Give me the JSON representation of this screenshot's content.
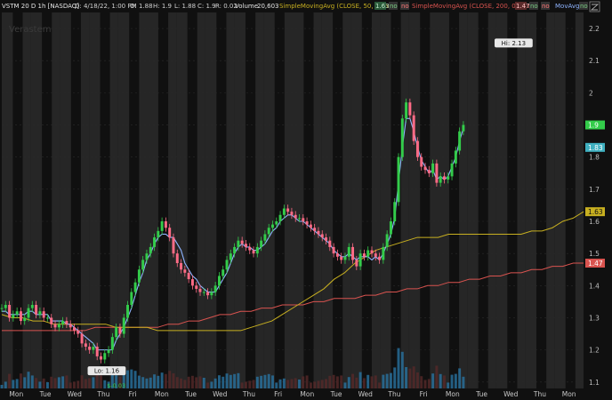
{
  "header": {
    "symbol": "VSTM 20 D 1h [NASDAQ]",
    "date_label": "D: 4/18/22, 1:00 PM",
    "open_label": "O: 1.88",
    "high_label": "H: 1.9",
    "low_label": "L: 1.88",
    "close_label": "C: 1.9",
    "range_label": "R: 0.02",
    "volume_label": "Volume",
    "volume_value": "20,603",
    "sma50_label": "SimpleMovingAvg (CLOSE, 50, 0, yes)",
    "sma50_value": "1.63",
    "na_1": "no",
    "sma200_label": "SimpleMovingAvg (CLOSE, 200, 0, yes)",
    "sma200_value": "1.47",
    "na_2": "no",
    "movavg_label": "MovAvg"
  },
  "watermark": "Verastem",
  "colors": {
    "background": "#101010",
    "session_band": "#2a2a2a",
    "bull": "#33cc4a",
    "bear": "#ff6b86",
    "sma50": "#c8b020",
    "sma200": "#d9534f",
    "ma_fast": "#8fb4ff",
    "volume": "#2a78a8",
    "volume_bear": "#5a2a2a"
  },
  "chart_data": {
    "type": "candlestick",
    "ylim": [
      1.08,
      2.25
    ],
    "yticks": [
      1.1,
      1.2,
      1.3,
      1.4,
      1.5,
      1.6,
      1.7,
      1.8,
      1.9,
      2.0,
      2.1,
      2.2
    ],
    "ytick_labels": [
      "1.1",
      "1.2",
      "1.3",
      "1.4",
      "1.5",
      "1.6",
      "1.7",
      "1.8",
      "1.9",
      "2",
      "2.1",
      "2.2"
    ],
    "xtick_labels": [
      "Mon",
      "Tue",
      "Wed",
      "Thu",
      "Fri",
      "Mon",
      "Tue",
      "Wed",
      "Thu",
      "Fri",
      "Mon",
      "Tue",
      "Wed",
      "Thu",
      "Fri",
      "Mon",
      "Tue",
      "Wed",
      "Thu",
      "Mon"
    ],
    "price_x": [
      0,
      24,
      48,
      72,
      96,
      120,
      144,
      168,
      192,
      216,
      240,
      264,
      288,
      312,
      336,
      360,
      384,
      408,
      432,
      456,
      480,
      504,
      528,
      552,
      576,
      600,
      624,
      648,
      672,
      696,
      720,
      744,
      768,
      792,
      816,
      840,
      864,
      888,
      912,
      936,
      960,
      984,
      1008,
      1032,
      1056,
      1080,
      1104,
      1128,
      1152,
      1176,
      1200,
      1224,
      1248,
      1272,
      1296,
      1320,
      1344,
      1368,
      1392,
      1416,
      1440,
      1464,
      1488,
      1512,
      1536,
      1560,
      1584,
      1608,
      1632,
      1656,
      1680,
      1704,
      1728,
      1752,
      1776,
      1800,
      1824,
      1848,
      1872,
      1896,
      1920,
      1944,
      1968,
      1992,
      2016,
      2040,
      2064,
      2088,
      2112,
      2136,
      2160,
      2184,
      2208,
      2232,
      2256,
      2280,
      2304,
      2328,
      2352,
      2376,
      2400,
      2424,
      2448,
      2472,
      2496,
      2520,
      2544,
      2568,
      2592,
      2616,
      2640,
      2664,
      2688,
      2712,
      2736,
      2760,
      2784,
      2808,
      2832,
      2856,
      2880,
      2904,
      2928,
      2952,
      2976,
      3000,
      3024,
      3048,
      3072,
      3096,
      3120,
      3144,
      3168,
      3192,
      3216,
      3240,
      3264,
      3288,
      3312,
      3336,
      3360,
      3384,
      3408,
      3432,
      3456,
      3480,
      3504,
      3528,
      3552,
      3576,
      3600,
      3624,
      3648
    ],
    "price_close": [
      1.33,
      1.34,
      1.3,
      1.31,
      1.32,
      1.29,
      1.3,
      1.33,
      1.34,
      1.31,
      1.32,
      1.3,
      1.3,
      1.28,
      1.27,
      1.28,
      1.29,
      1.28,
      1.27,
      1.26,
      1.25,
      1.22,
      1.21,
      1.2,
      1.21,
      1.18,
      1.17,
      1.19,
      1.2,
      1.24,
      1.27,
      1.25,
      1.3,
      1.34,
      1.38,
      1.41,
      1.45,
      1.48,
      1.5,
      1.52,
      1.55,
      1.57,
      1.6,
      1.58,
      1.55,
      1.5,
      1.47,
      1.45,
      1.44,
      1.42,
      1.4,
      1.39,
      1.38,
      1.38,
      1.37,
      1.38,
      1.4,
      1.43,
      1.45,
      1.48,
      1.5,
      1.52,
      1.54,
      1.53,
      1.52,
      1.51,
      1.5,
      1.52,
      1.54,
      1.56,
      1.58,
      1.59,
      1.6,
      1.62,
      1.64,
      1.63,
      1.62,
      1.61,
      1.61,
      1.6,
      1.59,
      1.58,
      1.57,
      1.56,
      1.55,
      1.54,
      1.52,
      1.5,
      1.49,
      1.48,
      1.49,
      1.52,
      1.48,
      1.46,
      1.5,
      1.49,
      1.51,
      1.5,
      1.49,
      1.48,
      1.52,
      1.56,
      1.6,
      1.66,
      1.8,
      1.92,
      1.97,
      1.93,
      1.85,
      1.8,
      1.77,
      1.76,
      1.75,
      1.78,
      1.72,
      1.74,
      1.73,
      1.74,
      1.78,
      1.82,
      1.88,
      1.9
    ],
    "sma50": [
      1.31,
      1.3,
      1.3,
      1.29,
      1.29,
      1.28,
      1.28,
      1.28,
      1.28,
      1.28,
      1.28,
      1.27,
      1.27,
      1.27,
      1.27,
      1.26,
      1.26,
      1.26,
      1.26,
      1.26,
      1.26,
      1.26,
      1.26,
      1.26,
      1.27,
      1.28,
      1.29,
      1.31,
      1.33,
      1.35,
      1.37,
      1.39,
      1.42,
      1.44,
      1.47,
      1.49,
      1.51,
      1.52,
      1.53,
      1.54,
      1.55,
      1.55,
      1.55,
      1.56,
      1.56,
      1.56,
      1.56,
      1.56,
      1.56,
      1.56,
      1.56,
      1.57,
      1.57,
      1.58,
      1.6,
      1.61,
      1.63
    ],
    "sma200": [
      1.26,
      1.26,
      1.26,
      1.26,
      1.26,
      1.26,
      1.26,
      1.26,
      1.26,
      1.27,
      1.27,
      1.27,
      1.27,
      1.27,
      1.27,
      1.27,
      1.28,
      1.28,
      1.29,
      1.29,
      1.3,
      1.31,
      1.31,
      1.32,
      1.32,
      1.33,
      1.33,
      1.34,
      1.34,
      1.34,
      1.35,
      1.35,
      1.36,
      1.36,
      1.36,
      1.37,
      1.37,
      1.38,
      1.38,
      1.39,
      1.39,
      1.4,
      1.4,
      1.41,
      1.41,
      1.42,
      1.42,
      1.43,
      1.43,
      1.44,
      1.44,
      1.45,
      1.45,
      1.46,
      1.46,
      1.47,
      1.47
    ],
    "ma_fast": [
      1.32,
      1.32,
      1.31,
      1.31,
      1.31,
      1.31,
      1.31,
      1.32,
      1.32,
      1.31,
      1.31,
      1.31,
      1.31,
      1.29,
      1.29,
      1.29,
      1.29,
      1.28,
      1.28,
      1.27,
      1.26,
      1.25,
      1.24,
      1.23,
      1.22,
      1.2,
      1.2,
      1.2,
      1.2,
      1.2,
      1.23,
      1.25,
      1.27,
      1.3,
      1.33,
      1.37,
      1.41,
      1.44,
      1.48,
      1.5,
      1.53,
      1.55,
      1.56,
      1.56,
      1.55,
      1.55,
      1.53,
      1.51,
      1.47,
      1.45,
      1.43,
      1.42,
      1.4,
      1.39,
      1.38,
      1.38,
      1.38,
      1.4,
      1.42,
      1.44,
      1.47,
      1.5,
      1.52,
      1.53,
      1.52,
      1.52,
      1.51,
      1.51,
      1.52,
      1.53,
      1.55,
      1.57,
      1.58,
      1.6,
      1.61,
      1.62,
      1.62,
      1.61,
      1.6,
      1.6,
      1.59,
      1.58,
      1.57,
      1.56,
      1.55,
      1.54,
      1.53,
      1.51,
      1.5,
      1.49,
      1.49,
      1.5,
      1.49,
      1.48,
      1.49,
      1.49,
      1.49,
      1.48,
      1.49,
      1.48,
      1.5,
      1.53,
      1.56,
      1.61,
      1.72,
      1.83,
      1.92,
      1.92,
      1.88,
      1.83,
      1.79,
      1.77,
      1.75,
      1.76,
      1.73,
      1.74,
      1.73,
      1.74,
      1.77,
      1.8,
      1.85,
      1.89
    ],
    "high_value": 2.13,
    "high_label": "Hi: 2.13",
    "low_value": 1.16,
    "low_label": "Lo: 1.16",
    "event_label": "$-0.03",
    "current_price": 1.9,
    "current_price_label": "1.9",
    "ma_fast_current": 1.83,
    "ma_fast_current_label": "1.83",
    "sma50_current": 1.63,
    "sma50_current_label": "1.63",
    "sma200_current": 1.47,
    "sma200_current_label": "1.47"
  }
}
